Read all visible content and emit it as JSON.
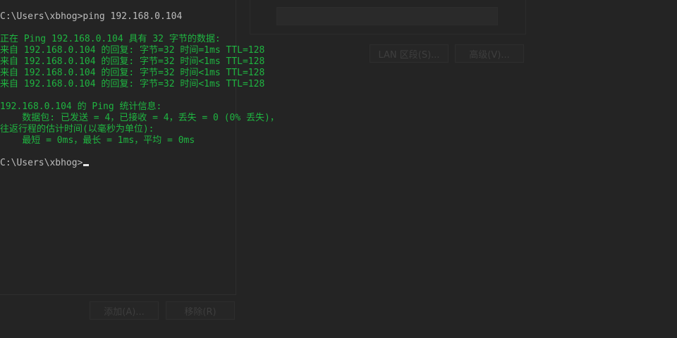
{
  "background_dialog": {
    "lan_button": "LAN 区段(S)...",
    "advanced_button": "高级(V)...",
    "add_button": "添加(A)...",
    "remove_button": "移除(R)"
  },
  "console": {
    "prompt_1": "C:\\Users\\xbhog>ping 192.168.0.104",
    "ping_header": "正在 Ping 192.168.0.104 具有 32 字节的数据:",
    "replies": [
      "来自 192.168.0.104 的回复: 字节=32 时间=1ms TTL=128",
      "来自 192.168.0.104 的回复: 字节=32 时间<1ms TTL=128",
      "来自 192.168.0.104 的回复: 字节=32 时间<1ms TTL=128",
      "来自 192.168.0.104 的回复: 字节=32 时间<1ms TTL=128"
    ],
    "stats_header": "192.168.0.104 的 Ping 统计信息:",
    "stats_packets": "    数据包: 已发送 = 4，已接收 = 4，丢失 = 0 (0% 丢失)，",
    "rtt_header": "往返行程的估计时间(以毫秒为单位):",
    "rtt_values": "    最短 = 0ms，最长 = 1ms，平均 = 0ms",
    "prompt_2": "C:\\Users\\xbhog>"
  },
  "colors": {
    "console_text": "#1fb541",
    "background": "#242424"
  }
}
